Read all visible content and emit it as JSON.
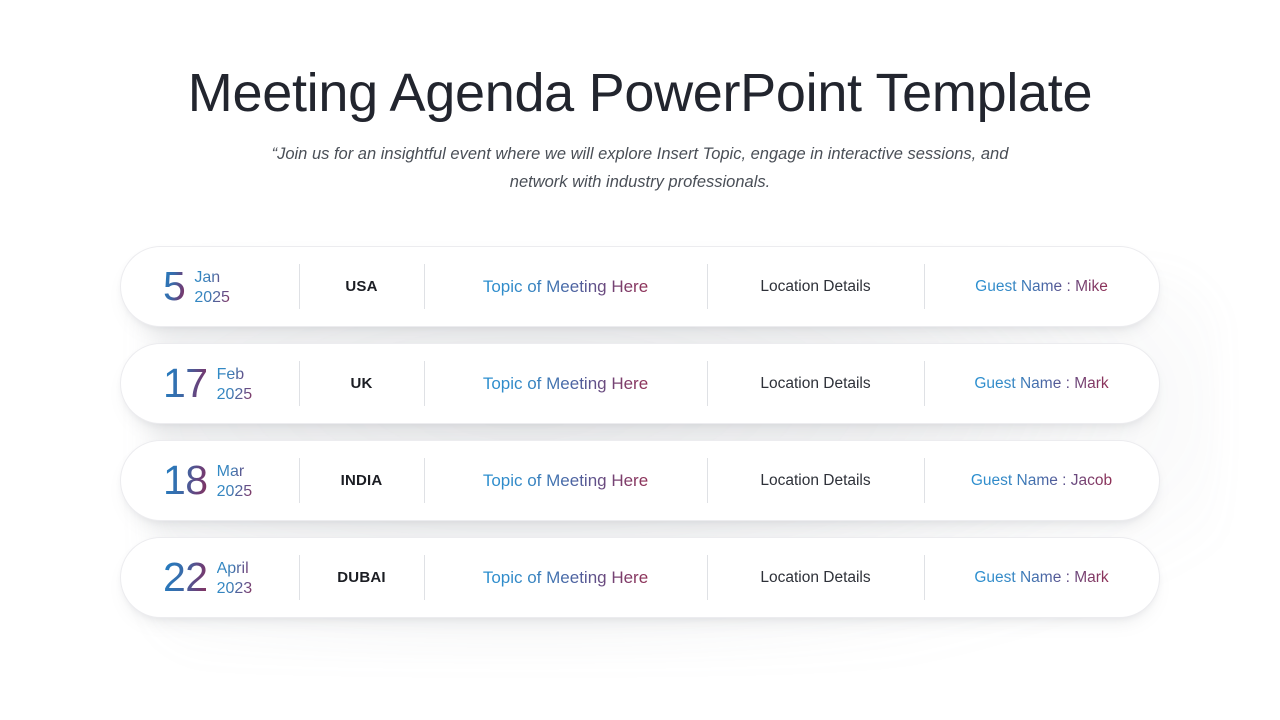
{
  "header": {
    "title": "Meeting Agenda PowerPoint Template",
    "subtitle": "“Join us for an insightful  event where we will explore Insert Topic, engage in interactive sessions, and network with industry professionals."
  },
  "colors": {
    "title": "#22252e",
    "subtitle": "#4a4f57",
    "gradient_start": "#2a8fd0",
    "gradient_end": "#8f2f55",
    "country": "#1b1d23",
    "location": "#2e3139",
    "divider": "#dfe1e5",
    "card_background": "#ffffff",
    "page_background": "#ffffff"
  },
  "rows": [
    {
      "day": "5",
      "month": "Jan",
      "year": "2025",
      "country": "USA",
      "topic": "Topic  of Meeting  Here",
      "location": "Location Details",
      "guest": "Guest Name : Mike"
    },
    {
      "day": "17",
      "month": "Feb",
      "year": "2025",
      "country": "UK",
      "topic": "Topic  of Meeting  Here",
      "location": "Location Details",
      "guest": "Guest Name : Mark"
    },
    {
      "day": "18",
      "month": "Mar",
      "year": "2025",
      "country": "INDIA",
      "topic": "Topic  of Meeting  Here",
      "location": "Location Details",
      "guest": "Guest Name : Jacob"
    },
    {
      "day": "22",
      "month": "April",
      "year": "2023",
      "country": "DUBAI",
      "topic": "Topic  of Meeting  Here",
      "location": "Location Details",
      "guest": "Guest Name : Mark"
    }
  ]
}
